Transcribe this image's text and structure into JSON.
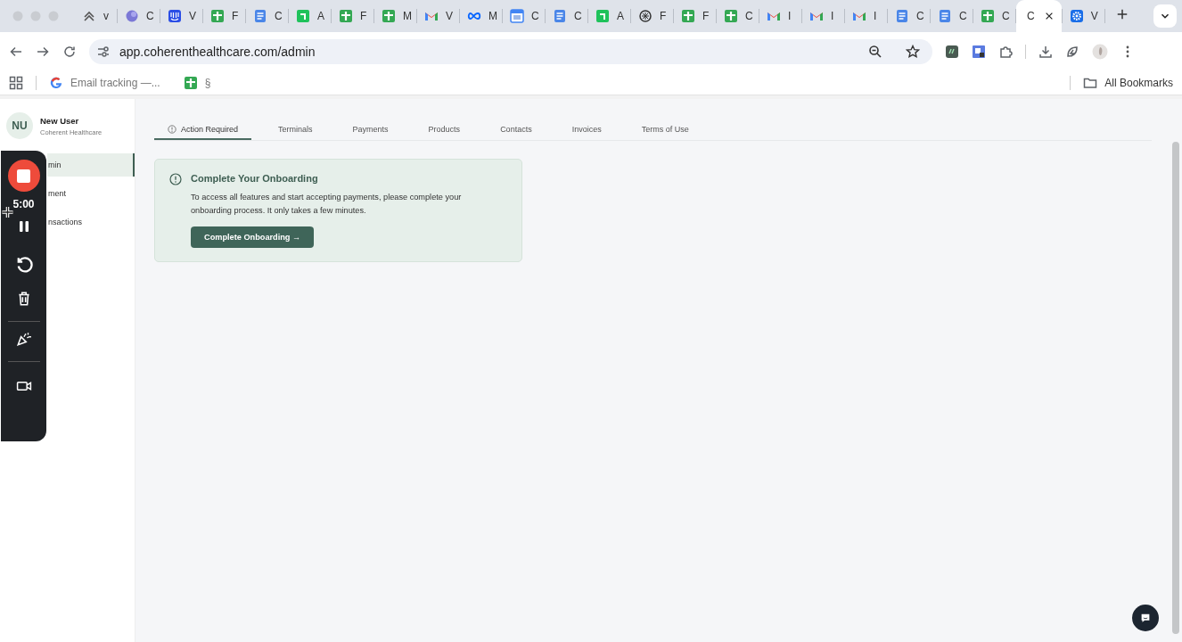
{
  "browser": {
    "tabs": [
      {
        "kind": "chevrons",
        "label": "v",
        "selected": false
      },
      {
        "kind": "circle",
        "label": "C",
        "selected": false
      },
      {
        "kind": "bars",
        "label": "V",
        "selected": false
      },
      {
        "kind": "sheet",
        "label": "F",
        "selected": false
      },
      {
        "kind": "doc",
        "label": "C",
        "selected": false
      },
      {
        "kind": "corner",
        "label": "A",
        "selected": false
      },
      {
        "kind": "sheet",
        "label": "F",
        "selected": false
      },
      {
        "kind": "sheet",
        "label": "M",
        "selected": false
      },
      {
        "kind": "mail",
        "label": "V",
        "selected": false
      },
      {
        "kind": "loop",
        "label": "M",
        "selected": false
      },
      {
        "kind": "calendar",
        "label": "C",
        "selected": false
      },
      {
        "kind": "doc",
        "label": "C",
        "selected": false
      },
      {
        "kind": "corner",
        "label": "A",
        "selected": false
      },
      {
        "kind": "knot",
        "label": "F",
        "selected": false
      },
      {
        "kind": "sheet",
        "label": "F",
        "selected": false
      },
      {
        "kind": "sheet",
        "label": "C",
        "selected": false
      },
      {
        "kind": "mail",
        "label": "I",
        "selected": false
      },
      {
        "kind": "mail",
        "label": "I",
        "selected": false
      },
      {
        "kind": "mail",
        "label": "I",
        "selected": false
      },
      {
        "kind": "doc",
        "label": "C",
        "selected": false
      },
      {
        "kind": "doc",
        "label": "C",
        "selected": false
      },
      {
        "kind": "sheet",
        "label": "C",
        "selected": false
      },
      {
        "kind": "none",
        "label": "C",
        "selected": true
      },
      {
        "kind": "gear",
        "label": "V",
        "selected": false
      }
    ],
    "address": "app.coherenthealthcare.com/admin",
    "bookmarks": [
      {
        "kind": "google",
        "label": "Email tracking —..."
      },
      {
        "kind": "sheet",
        "label": "§"
      }
    ],
    "all_bookmarks": "All Bookmarks"
  },
  "sidebar": {
    "avatar": "NU",
    "user_name": "New User",
    "org": "Coherent Healthcare",
    "items": [
      {
        "label": "min",
        "selected": true
      },
      {
        "label": "ment",
        "selected": false
      },
      {
        "label": "nsactions",
        "selected": false
      }
    ]
  },
  "tabs": [
    {
      "label": "Action Required",
      "selected": true,
      "kind": "alert"
    },
    {
      "label": "Terminals",
      "selected": false,
      "kind": "plain"
    },
    {
      "label": "Payments",
      "selected": false,
      "kind": "plain"
    },
    {
      "label": "Products",
      "selected": false,
      "kind": "plain"
    },
    {
      "label": "Contacts",
      "selected": false,
      "kind": "plain"
    },
    {
      "label": "Invoices",
      "selected": false,
      "kind": "plain"
    },
    {
      "label": "Terms of Use",
      "selected": false,
      "kind": "plain"
    }
  ],
  "card": {
    "title": "Complete Your Onboarding",
    "body": "To access all features and start accepting payments, please complete your onboarding process. It only takes a few minutes.",
    "button": "Complete Onboarding →"
  },
  "recorder": {
    "timer": "5:00"
  }
}
